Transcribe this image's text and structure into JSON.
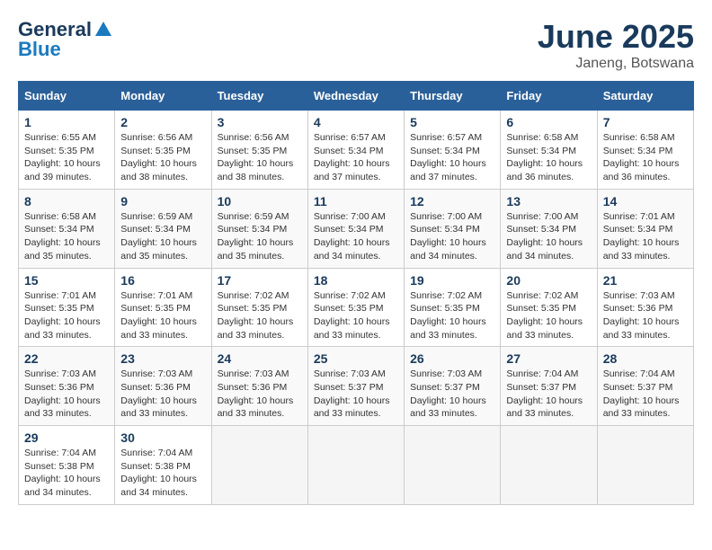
{
  "logo": {
    "general": "General",
    "blue": "Blue"
  },
  "title": "June 2025",
  "location": "Janeng, Botswana",
  "headers": [
    "Sunday",
    "Monday",
    "Tuesday",
    "Wednesday",
    "Thursday",
    "Friday",
    "Saturday"
  ],
  "weeks": [
    [
      {
        "day": "1",
        "sunrise": "6:55 AM",
        "sunset": "5:35 PM",
        "daylight": "10 hours and 39 minutes."
      },
      {
        "day": "2",
        "sunrise": "6:56 AM",
        "sunset": "5:35 PM",
        "daylight": "10 hours and 38 minutes."
      },
      {
        "day": "3",
        "sunrise": "6:56 AM",
        "sunset": "5:35 PM",
        "daylight": "10 hours and 38 minutes."
      },
      {
        "day": "4",
        "sunrise": "6:57 AM",
        "sunset": "5:34 PM",
        "daylight": "10 hours and 37 minutes."
      },
      {
        "day": "5",
        "sunrise": "6:57 AM",
        "sunset": "5:34 PM",
        "daylight": "10 hours and 37 minutes."
      },
      {
        "day": "6",
        "sunrise": "6:58 AM",
        "sunset": "5:34 PM",
        "daylight": "10 hours and 36 minutes."
      },
      {
        "day": "7",
        "sunrise": "6:58 AM",
        "sunset": "5:34 PM",
        "daylight": "10 hours and 36 minutes."
      }
    ],
    [
      {
        "day": "8",
        "sunrise": "6:58 AM",
        "sunset": "5:34 PM",
        "daylight": "10 hours and 35 minutes."
      },
      {
        "day": "9",
        "sunrise": "6:59 AM",
        "sunset": "5:34 PM",
        "daylight": "10 hours and 35 minutes."
      },
      {
        "day": "10",
        "sunrise": "6:59 AM",
        "sunset": "5:34 PM",
        "daylight": "10 hours and 35 minutes."
      },
      {
        "day": "11",
        "sunrise": "7:00 AM",
        "sunset": "5:34 PM",
        "daylight": "10 hours and 34 minutes."
      },
      {
        "day": "12",
        "sunrise": "7:00 AM",
        "sunset": "5:34 PM",
        "daylight": "10 hours and 34 minutes."
      },
      {
        "day": "13",
        "sunrise": "7:00 AM",
        "sunset": "5:34 PM",
        "daylight": "10 hours and 34 minutes."
      },
      {
        "day": "14",
        "sunrise": "7:01 AM",
        "sunset": "5:34 PM",
        "daylight": "10 hours and 33 minutes."
      }
    ],
    [
      {
        "day": "15",
        "sunrise": "7:01 AM",
        "sunset": "5:35 PM",
        "daylight": "10 hours and 33 minutes."
      },
      {
        "day": "16",
        "sunrise": "7:01 AM",
        "sunset": "5:35 PM",
        "daylight": "10 hours and 33 minutes."
      },
      {
        "day": "17",
        "sunrise": "7:02 AM",
        "sunset": "5:35 PM",
        "daylight": "10 hours and 33 minutes."
      },
      {
        "day": "18",
        "sunrise": "7:02 AM",
        "sunset": "5:35 PM",
        "daylight": "10 hours and 33 minutes."
      },
      {
        "day": "19",
        "sunrise": "7:02 AM",
        "sunset": "5:35 PM",
        "daylight": "10 hours and 33 minutes."
      },
      {
        "day": "20",
        "sunrise": "7:02 AM",
        "sunset": "5:35 PM",
        "daylight": "10 hours and 33 minutes."
      },
      {
        "day": "21",
        "sunrise": "7:03 AM",
        "sunset": "5:36 PM",
        "daylight": "10 hours and 33 minutes."
      }
    ],
    [
      {
        "day": "22",
        "sunrise": "7:03 AM",
        "sunset": "5:36 PM",
        "daylight": "10 hours and 33 minutes."
      },
      {
        "day": "23",
        "sunrise": "7:03 AM",
        "sunset": "5:36 PM",
        "daylight": "10 hours and 33 minutes."
      },
      {
        "day": "24",
        "sunrise": "7:03 AM",
        "sunset": "5:36 PM",
        "daylight": "10 hours and 33 minutes."
      },
      {
        "day": "25",
        "sunrise": "7:03 AM",
        "sunset": "5:37 PM",
        "daylight": "10 hours and 33 minutes."
      },
      {
        "day": "26",
        "sunrise": "7:03 AM",
        "sunset": "5:37 PM",
        "daylight": "10 hours and 33 minutes."
      },
      {
        "day": "27",
        "sunrise": "7:04 AM",
        "sunset": "5:37 PM",
        "daylight": "10 hours and 33 minutes."
      },
      {
        "day": "28",
        "sunrise": "7:04 AM",
        "sunset": "5:37 PM",
        "daylight": "10 hours and 33 minutes."
      }
    ],
    [
      {
        "day": "29",
        "sunrise": "7:04 AM",
        "sunset": "5:38 PM",
        "daylight": "10 hours and 34 minutes."
      },
      {
        "day": "30",
        "sunrise": "7:04 AM",
        "sunset": "5:38 PM",
        "daylight": "10 hours and 34 minutes."
      },
      null,
      null,
      null,
      null,
      null
    ]
  ]
}
